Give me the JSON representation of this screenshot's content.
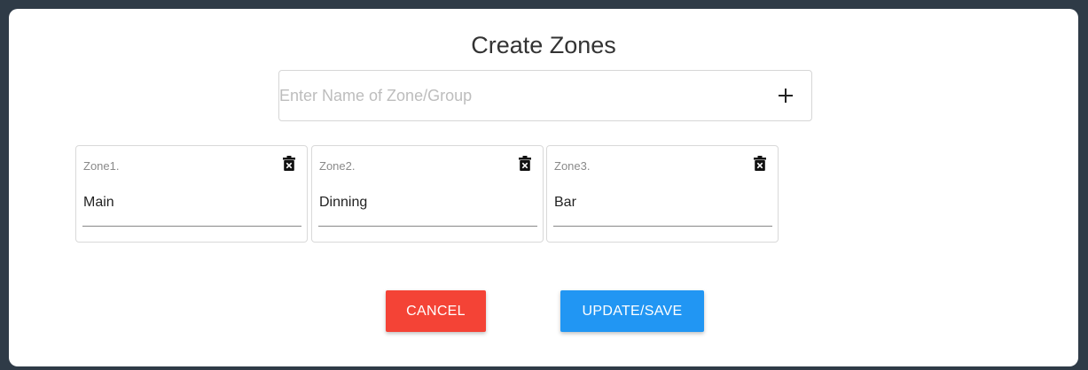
{
  "dialog": {
    "title": "Create Zones",
    "name_input": {
      "placeholder": "Enter Name of Zone/Group",
      "value": ""
    },
    "add_icon": "plus-icon"
  },
  "zones": [
    {
      "label": "Zone1.",
      "value": "Main"
    },
    {
      "label": "Zone2.",
      "value": "Dinning"
    },
    {
      "label": "Zone3.",
      "value": "Bar"
    }
  ],
  "buttons": {
    "cancel_label": "CANCEL",
    "save_label": "UPDATE/SAVE"
  },
  "colors": {
    "cancel": "#f44336",
    "save": "#2196f3",
    "backdrop": "#2f3b47"
  }
}
